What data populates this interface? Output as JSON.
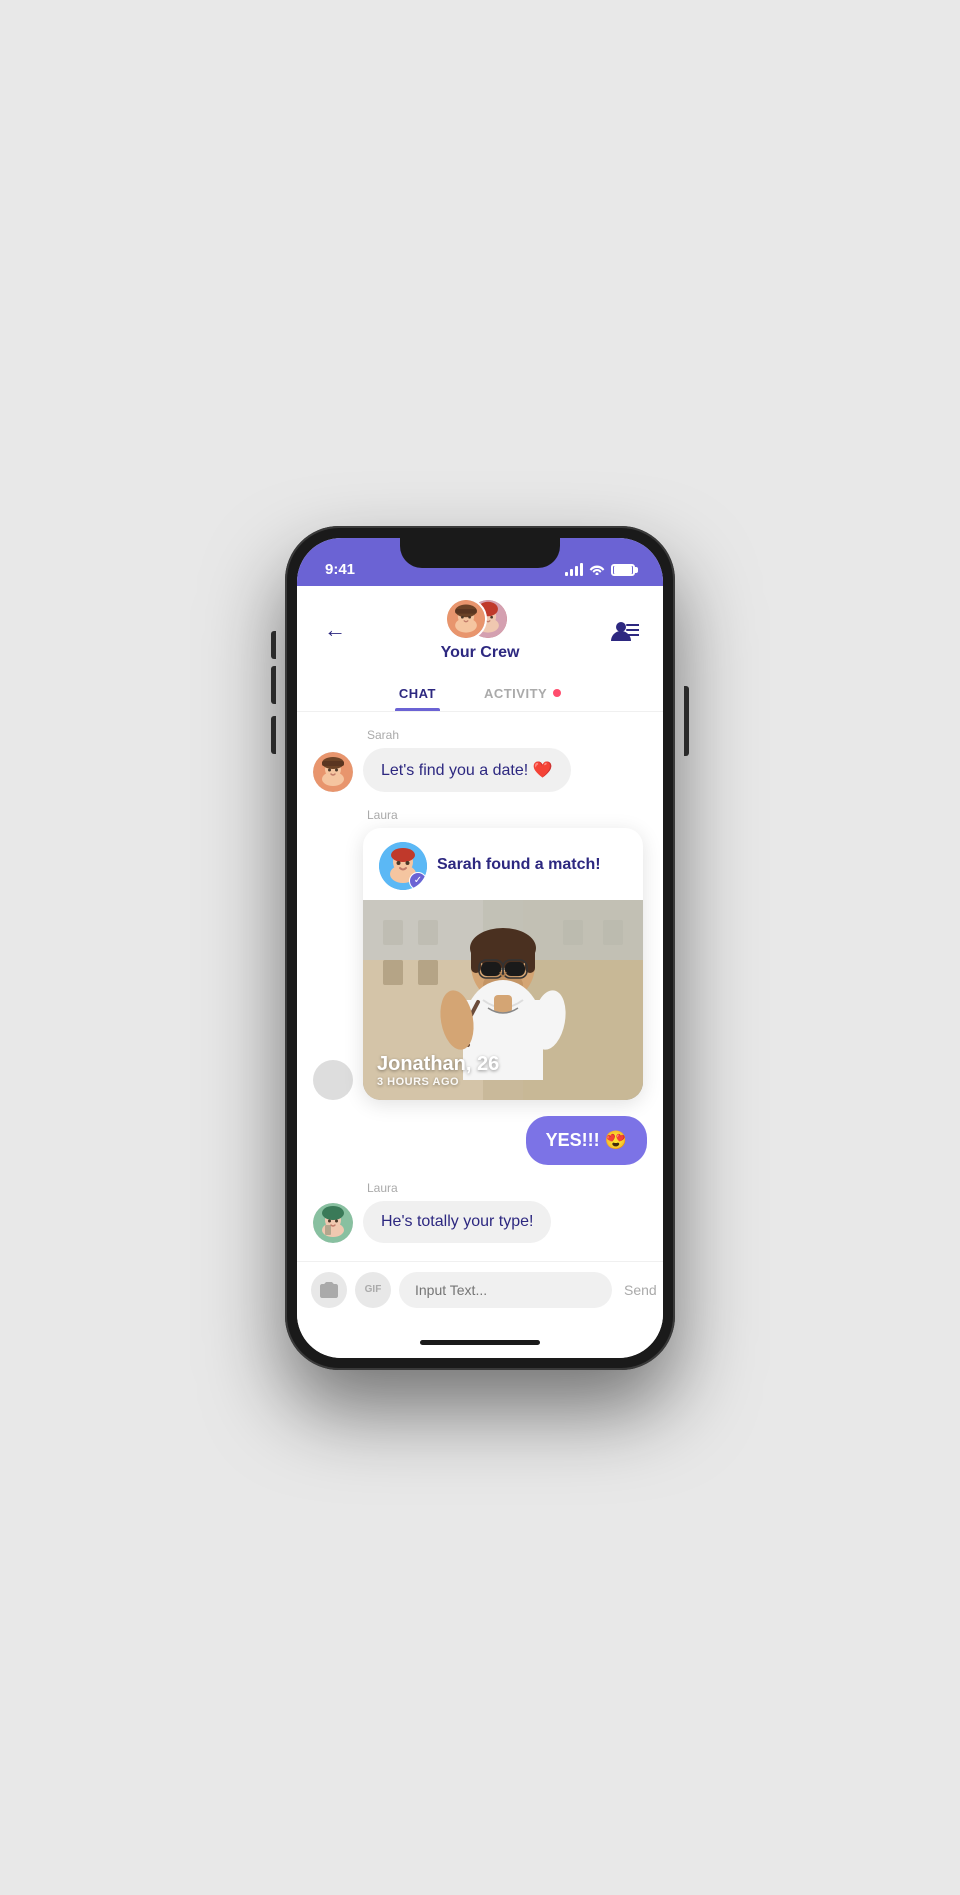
{
  "status": {
    "time": "9:41",
    "battery_full": true
  },
  "header": {
    "crew_name": "Your Crew",
    "back_label": "←",
    "tab_chat": "CHAT",
    "tab_activity": "ACTIVITY"
  },
  "messages": [
    {
      "id": "msg1",
      "sender": "Sarah",
      "text": "Let's find you a date! ❤️",
      "type": "incoming"
    },
    {
      "id": "msg2",
      "sender": "Laura",
      "type": "match-card",
      "match_title": "Sarah found a match!",
      "match_person": "Jonathan, 26",
      "match_time": "3 HOURS AGO"
    },
    {
      "id": "msg3",
      "sender": "me",
      "text": "YES!!! 😍",
      "type": "outgoing"
    },
    {
      "id": "msg4",
      "sender": "Laura",
      "text": "He's totally your type!",
      "type": "incoming"
    }
  ],
  "input": {
    "placeholder": "Input Text...",
    "send_label": "Send",
    "gif_label": "GIF"
  },
  "icons": {
    "back": "←",
    "contacts": "👤≡",
    "camera": "📷",
    "gif": "GIF",
    "check": "✓"
  }
}
